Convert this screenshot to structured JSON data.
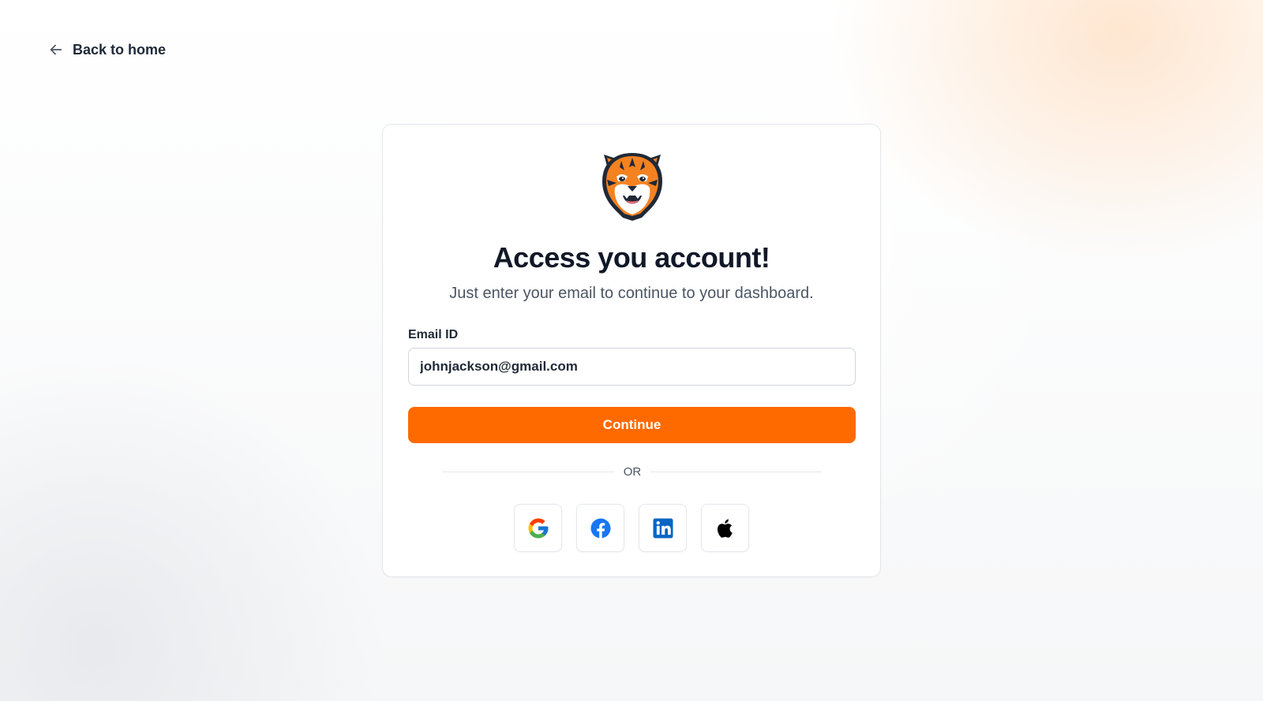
{
  "nav": {
    "back_label": "Back to home",
    "back_icon": "arrow-left-icon"
  },
  "card": {
    "logo_icon": "tiger-logo",
    "title": "Access you account!",
    "subtitle": "Just enter your email to continue to your dashboard.",
    "email_label": "Email ID",
    "email_value": "johnjackson@gmail.com",
    "continue_label": "Continue",
    "divider_text": "OR",
    "social_providers": [
      {
        "name": "Google",
        "icon": "google-icon"
      },
      {
        "name": "Facebook",
        "icon": "facebook-icon"
      },
      {
        "name": "LinkedIn",
        "icon": "linkedin-icon"
      },
      {
        "name": "Apple",
        "icon": "apple-icon"
      }
    ]
  },
  "colors": {
    "accent": "#ff6a00",
    "text_primary": "#111827",
    "text_secondary": "#4b5563",
    "border": "#e5e7eb"
  }
}
